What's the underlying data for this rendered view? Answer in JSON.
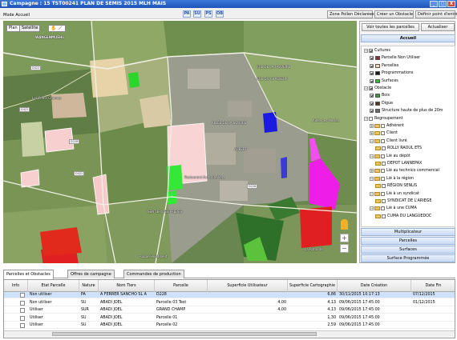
{
  "window": {
    "title": "Campagne : 15  TST00241 PLAN DE SEMIS 2015 MLH MAIS",
    "min": "_",
    "max": "□",
    "close": "X"
  },
  "toolbar": {
    "mode": "Mode Accueil",
    "filters": [
      "PA",
      "SU",
      "PS",
      "OB"
    ],
    "zone_pollen": "Zone Pollen Déclarées",
    "creer_obstacle": "Créer un Obstacle",
    "definir_entree": "Définir point d'entrée"
  },
  "map": {
    "tabs": {
      "plan": "Plan",
      "satellite": "Satellite"
    },
    "labels": [
      "WANGENMUEHL",
      "Les Petits Champs",
      "RUE DE LA FAUVERIE",
      "RUE DU CHASSEUR",
      "ALLÉE DE LA SOURCE",
      "AUBERT",
      "Restaurant Au Arbre Vert",
      "Roque Huleboeuf",
      "La Rotonde",
      "SENTIER DES FRÈRES",
      "Allée des Merles"
    ],
    "road_tags": [
      "D422",
      "D228",
      "D422",
      "D228",
      "D422"
    ],
    "zoom_in": "+",
    "zoom_out": "−"
  },
  "right_panel": {
    "voir_toutes": "Voir toutes les parcelles",
    "actualiser": "Actualiser",
    "accueil": "Accueil",
    "tree": [
      {
        "label": "Cultures",
        "level": 0,
        "exp": "−",
        "cb": true
      },
      {
        "label": "Parcelle Non Utiliser",
        "level": 1,
        "cb": true,
        "swatch": "#8b2d2d"
      },
      {
        "label": "Parcelles",
        "level": 1,
        "cb": true,
        "swatch": "#f4d7b8"
      },
      {
        "label": "Programmations",
        "level": 1,
        "cb": true,
        "swatch": "#1a1a1a"
      },
      {
        "label": "Surfaces",
        "level": 1,
        "cb": true,
        "swatch": "#2fbf2f"
      },
      {
        "label": "Obstacle",
        "level": 0,
        "exp": "−",
        "cb": true
      },
      {
        "label": "Bois",
        "level": 1,
        "cb": true,
        "swatch": "#3c9a3c"
      },
      {
        "label": "Digue",
        "level": 1,
        "cb": true,
        "swatch": "#5a3a1a"
      },
      {
        "label": "Structure haute de plus de 20m",
        "level": 1,
        "cb": true,
        "swatch": "#6b6b6b"
      },
      {
        "label": "Regroupement",
        "level": 0,
        "exp": "−",
        "cb": false
      },
      {
        "label": "Adhérent",
        "level": 1,
        "exp": "+",
        "cb": false,
        "folder": true
      },
      {
        "label": "Client",
        "level": 1,
        "exp": "+",
        "cb": false,
        "folder": true
      },
      {
        "label": "Client livré",
        "level": 1,
        "exp": "−",
        "cb": false,
        "folder": true
      },
      {
        "label": "ROLLY RAOUL ETS",
        "level": 2,
        "cb": false,
        "folder": true
      },
      {
        "label": "Lié au dépôt",
        "level": 1,
        "exp": "−",
        "cb": false,
        "folder": true
      },
      {
        "label": "DEPOT LANNEPAX",
        "level": 2,
        "cb": false,
        "folder": true
      },
      {
        "label": "Lié au technico commercial",
        "level": 1,
        "exp": "+",
        "cb": false,
        "folder": true
      },
      {
        "label": "Lié à la région",
        "level": 1,
        "exp": "−",
        "cb": false,
        "folder": true
      },
      {
        "label": "RÉGION SENLIS",
        "level": 2,
        "cb": false,
        "folder": true
      },
      {
        "label": "Lié à un syndicat",
        "level": 1,
        "exp": "−",
        "cb": false,
        "folder": true
      },
      {
        "label": "SYNDICAT DE L'ARIEGE",
        "level": 2,
        "cb": false,
        "folder": true
      },
      {
        "label": "Lié à une CUMA",
        "level": 1,
        "exp": "−",
        "cb": false,
        "folder": true
      },
      {
        "label": "CUMA DU LANGUEDOC",
        "level": 2,
        "cb": false,
        "folder": true
      }
    ],
    "sections": [
      "Multiplicateur",
      "Parcelles",
      "Surfaces",
      "Surface Programmée"
    ]
  },
  "grid": {
    "tabs": [
      "Parcelles et Obstacles",
      "Offres de campagne",
      "Commandes de production"
    ],
    "headers": [
      "Info",
      "Etat Parcelle",
      "Nature",
      "Nom Tiers",
      "Parcelle",
      "Superficie Utilisateur",
      "Superficie Cartographie",
      "Date Création",
      "Date Fin"
    ],
    "rows": [
      [
        "",
        "Non utiliser",
        "PA",
        "A FERRER SANCHO SL A",
        "D228",
        "",
        "6,86",
        "30/11/2015 10:17:13",
        "07/12/2015"
      ],
      [
        "",
        "Non utiliser",
        "SU",
        "ABADI JOEL",
        "Parcelle 03 Test",
        "4,00",
        "4,13",
        "09/06/2015 17:45:00",
        "01/12/2015"
      ],
      [
        "",
        "Utiliser",
        "SUR",
        "ABADI JOEL",
        "GRAND CHAMP",
        "4,00",
        "4,13",
        "09/06/2015 17:45:00",
        ""
      ],
      [
        "",
        "Utiliser",
        "SU",
        "ABADI JOEL",
        "Parcelle 01",
        "",
        "1,30",
        "09/06/2015 17:45:00",
        ""
      ],
      [
        "",
        "Utiliser",
        "SU",
        "ABADI JOEL",
        "Parcelle 02",
        "",
        "2,59",
        "09/06/2015 17:45:00",
        ""
      ]
    ]
  }
}
